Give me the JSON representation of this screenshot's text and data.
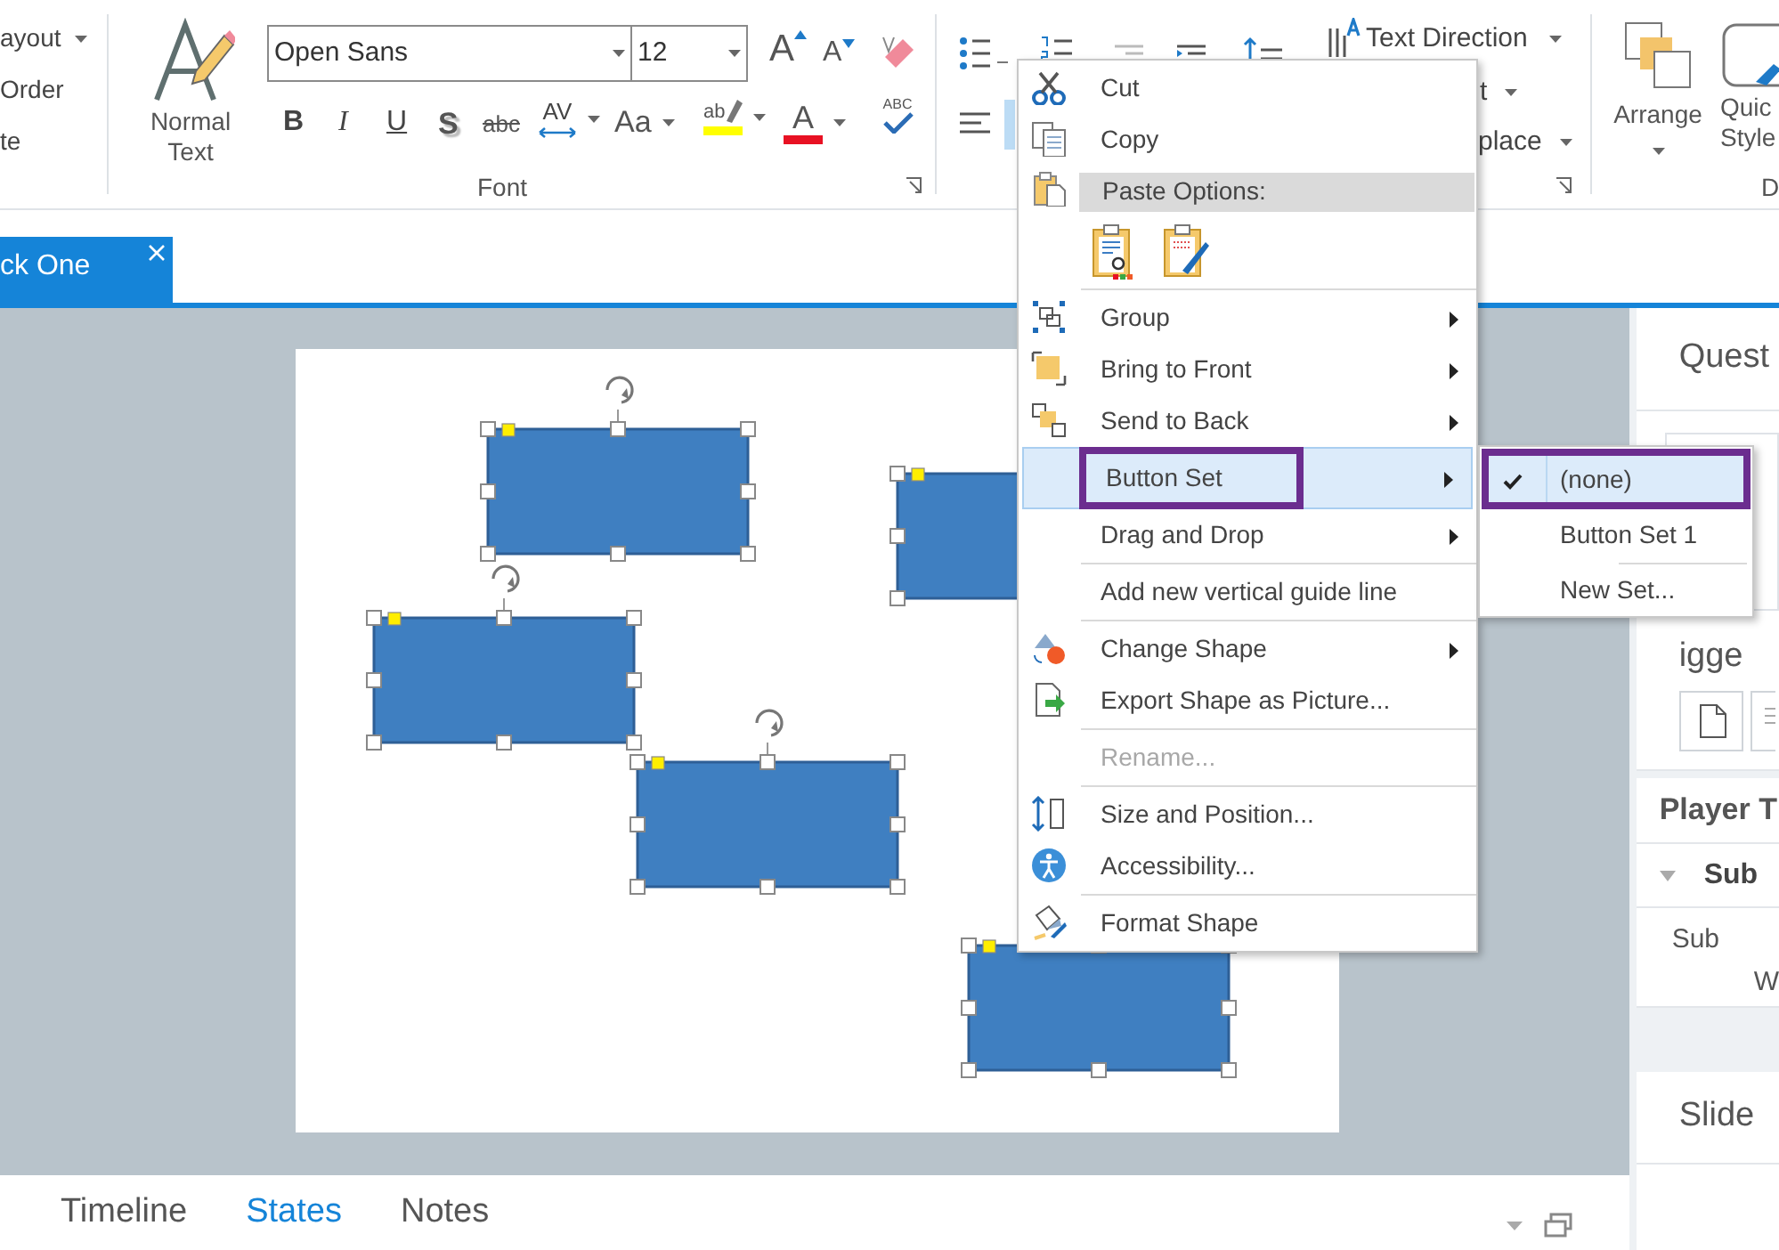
{
  "ribbon": {
    "partial_group": [
      {
        "label": "ayout",
        "dropdown": true
      },
      {
        "label": "Order",
        "dropdown": false
      },
      {
        "label": "te",
        "dropdown": false
      }
    ],
    "font_group": {
      "style_button": "Normal Text",
      "font_name": "Open Sans",
      "font_size": "12",
      "label": "Font",
      "buttons": [
        {
          "kind": "grow",
          "glyph": "A"
        },
        {
          "kind": "shrink",
          "glyph": "A"
        },
        {
          "kind": "bold",
          "glyph": "B"
        },
        {
          "kind": "italic",
          "glyph": "I"
        },
        {
          "kind": "underline",
          "glyph": "U"
        },
        {
          "kind": "shadow",
          "glyph": "S"
        },
        {
          "kind": "strike",
          "glyph": "abc"
        },
        {
          "kind": "spacing",
          "glyph": "AV"
        },
        {
          "kind": "case",
          "glyph": "Aa"
        },
        {
          "kind": "highlight",
          "glyph": "ab"
        },
        {
          "kind": "color",
          "glyph": "A"
        },
        {
          "kind": "spell",
          "glyph": "ABC"
        }
      ]
    },
    "paragraph_group": {
      "text_direction": "Text Direction",
      "align_partial": "t",
      "replace_partial": "place"
    },
    "drawing_group": {
      "arrange": "Arrange",
      "quick_styles": "Quic",
      "quick_styles_line2": "Style",
      "label_partial": "D"
    }
  },
  "document_tab": {
    "label": "ck One",
    "selected": true
  },
  "context_menu": [
    {
      "kind": "item",
      "label": "Cut",
      "submenu": false,
      "disabled": false,
      "selected": false,
      "outlined": false
    },
    {
      "kind": "item",
      "label": "Copy",
      "submenu": false,
      "disabled": false,
      "selected": false,
      "outlined": false
    },
    {
      "kind": "header",
      "label": "Paste Options:"
    },
    {
      "kind": "paste_options"
    },
    {
      "kind": "separator"
    },
    {
      "kind": "item",
      "label": "Group",
      "submenu": true,
      "disabled": false,
      "selected": false,
      "outlined": false
    },
    {
      "kind": "item",
      "label": "Bring to Front",
      "submenu": true,
      "disabled": false,
      "selected": false,
      "outlined": false
    },
    {
      "kind": "item",
      "label": "Send to Back",
      "submenu": true,
      "disabled": false,
      "selected": false,
      "outlined": false
    },
    {
      "kind": "item",
      "label": "Button Set",
      "submenu": true,
      "disabled": false,
      "selected": true,
      "outlined": true
    },
    {
      "kind": "item",
      "label": "Drag and Drop",
      "submenu": true,
      "disabled": false,
      "selected": false,
      "outlined": false
    },
    {
      "kind": "separator"
    },
    {
      "kind": "item",
      "label": "Add new vertical guide line",
      "submenu": false,
      "disabled": false,
      "selected": false,
      "outlined": false
    },
    {
      "kind": "separator"
    },
    {
      "kind": "item",
      "label": "Change Shape",
      "submenu": true,
      "disabled": false,
      "selected": false,
      "outlined": false
    },
    {
      "kind": "item",
      "label": "Export Shape as Picture...",
      "submenu": false,
      "disabled": false,
      "selected": false,
      "outlined": false
    },
    {
      "kind": "separator"
    },
    {
      "kind": "item",
      "label": "Rename...",
      "submenu": false,
      "disabled": true,
      "selected": false,
      "outlined": false
    },
    {
      "kind": "separator"
    },
    {
      "kind": "item",
      "label": "Size and Position...",
      "submenu": false,
      "disabled": false,
      "selected": false,
      "outlined": false
    },
    {
      "kind": "item",
      "label": "Accessibility...",
      "submenu": false,
      "disabled": false,
      "selected": false,
      "outlined": false
    },
    {
      "kind": "separator"
    },
    {
      "kind": "item",
      "label": "Format Shape",
      "submenu": false,
      "disabled": false,
      "selected": false,
      "outlined": false
    }
  ],
  "submenu": [
    {
      "kind": "item",
      "label": "(none)",
      "checked": true,
      "selected": true,
      "outlined": true
    },
    {
      "kind": "item",
      "label": "Button Set 1",
      "checked": false,
      "selected": false,
      "outlined": false
    },
    {
      "kind": "separator"
    },
    {
      "kind": "item",
      "label": "New Set...",
      "checked": false,
      "selected": false,
      "outlined": false
    }
  ],
  "right_panel": {
    "states_header": "Quest",
    "triggers_header": "igge",
    "player_header": "Player T",
    "player_group": {
      "label": "Sub",
      "expanded": true
    },
    "player_rows": [
      "Sub",
      "W"
    ],
    "slide_header": "Slide"
  },
  "bottom_tabs": [
    {
      "label": "Timeline",
      "selected": false
    },
    {
      "label": "States",
      "selected": true
    },
    {
      "label": "Notes",
      "selected": false
    }
  ]
}
